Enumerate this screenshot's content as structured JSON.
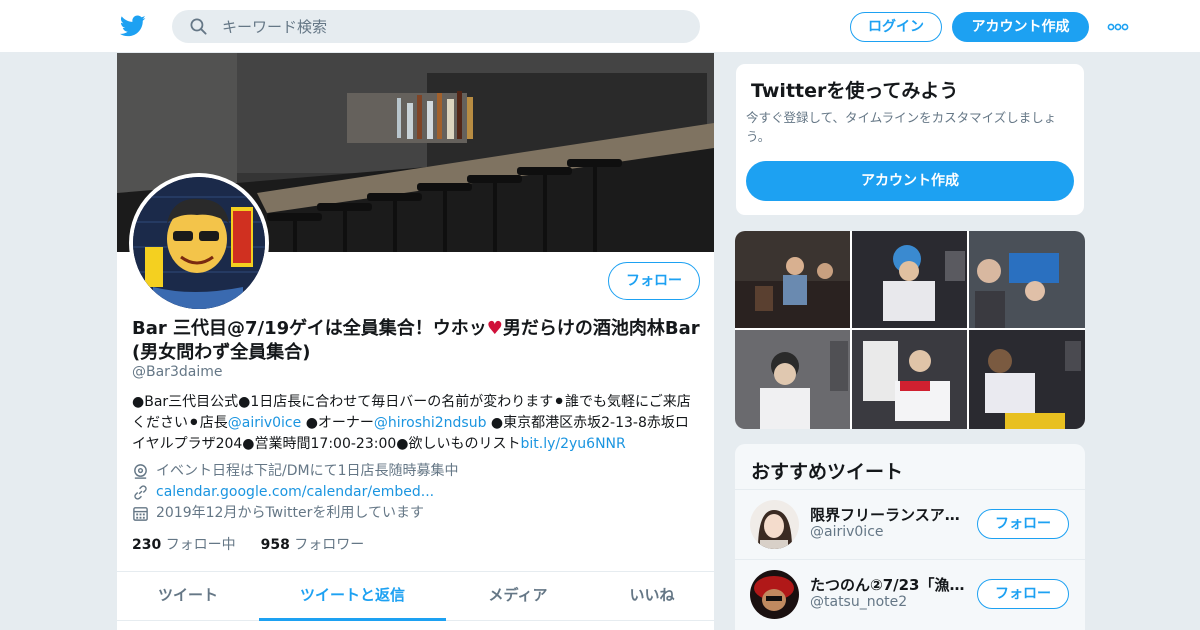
{
  "header": {
    "logo_icon": "twitter-bird-icon",
    "search_placeholder": "キーワード検索",
    "login_label": "ログイン",
    "signup_label": "アカウント作成",
    "more_icon": "more-dots-icon"
  },
  "profile": {
    "name_part1": "Bar 三代目@7/19ゲイは全員集合！ウホッ",
    "name_heart": "♥",
    "name_part2": "男だらけの酒池肉林Bar (男女問わず全員集合)",
    "handle": "@Bar3daime",
    "follow_label": "フォロー",
    "bio": {
      "t1": "●Bar三代目公式●1日店長に合わせて毎日バーの名前が変わります⚫誰でも気軽にご来店ください⚫店長",
      "l1": "@airiv0ice",
      "t2": " ●オーナー",
      "l2": "@hiroshi2ndsub",
      "t3": " ●東京都港区赤坂2-13-8赤坂ロイヤルプラザ204●営業時間17:00-23:00●欲しいものリスト",
      "l3": "bit.ly/2yu6NNR"
    },
    "location": "イベント日程は下記/DMにて1日店長随時募集中",
    "url": "calendar.google.com/calendar/embed...",
    "joined": "2019年12月からTwitterを利用しています",
    "following_count": "230",
    "following_label": "フォロー中",
    "followers_count": "958",
    "followers_label": "フォロワー",
    "tabs": [
      "ツイート",
      "ツイートと返信",
      "メディア",
      "いいね"
    ],
    "active_tab": 1
  },
  "signup_card": {
    "title": "Twitterを使ってみよう",
    "text": "今すぐ登録して、タイムラインをカスタマイズしましょう。",
    "button": "アカウント作成"
  },
  "recommended": {
    "title": "おすすめツイート",
    "items": [
      {
        "name": "限界フリーランスア…",
        "handle": "@airiv0ice",
        "button": "フォロー"
      },
      {
        "name": "たつのん②7/23「漁…",
        "handle": "@tatsu_note2",
        "button": "フォロー"
      }
    ]
  },
  "colors": {
    "accent": "#1da1f2",
    "link": "#1b95e0",
    "muted": "#657786",
    "background": "#e6ecf0"
  }
}
